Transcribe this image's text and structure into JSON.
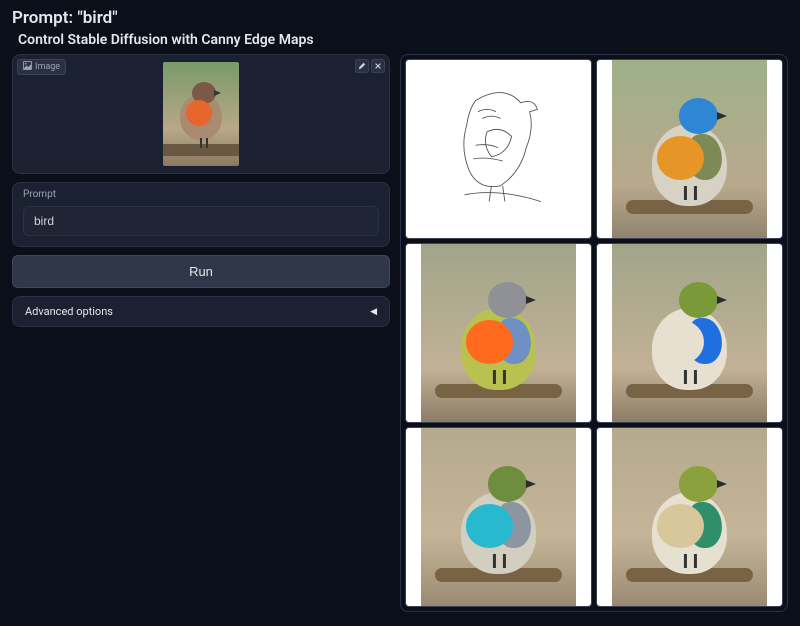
{
  "header": {
    "prompt_prefix": "Prompt: ",
    "prompt_value": "\"bird\"",
    "subtitle": "Control Stable Diffusion with Canny Edge Maps"
  },
  "image_input": {
    "chip_icon": "image-icon",
    "chip_label": "Image",
    "edit_icon": "pencil-icon",
    "close_icon": "close-icon"
  },
  "prompt_field": {
    "label": "Prompt",
    "value": "bird"
  },
  "run_button": {
    "label": "Run"
  },
  "advanced": {
    "label": "Advanced options",
    "expand_icon": "triangle-left-icon"
  },
  "outputs": [
    {
      "kind": "edge_map",
      "label": "canny-edge-map"
    },
    {
      "kind": "generated",
      "palette": {
        "head": "#2f86d4",
        "body": "#d8d2c4",
        "chest": "#e69627",
        "wing": "#7d8a55"
      }
    },
    {
      "kind": "generated",
      "palette": {
        "head": "#8f9196",
        "body": "#b9c24e",
        "chest": "#ff6a1f",
        "wing": "#6e90c4"
      }
    },
    {
      "kind": "generated",
      "palette": {
        "head": "#7a9a3a",
        "body": "#e7dfcf",
        "chest": "#e7dfcf",
        "wing": "#1f6fe0"
      }
    },
    {
      "kind": "generated",
      "palette": {
        "head": "#6f8d3f",
        "body": "#d2cec0",
        "chest": "#29b9cf",
        "wing": "#8c96a0"
      }
    },
    {
      "kind": "generated",
      "palette": {
        "head": "#8aa23e",
        "body": "#e5e0d0",
        "chest": "#d8c79a",
        "wing": "#2f8f6a"
      }
    }
  ],
  "colors": {
    "bg": "#0b0f1a",
    "panel": "#1b2131",
    "border": "#2a3142",
    "accent": "#2f3749"
  },
  "input_bird": {
    "head": "#7a5a46",
    "body": "#a98b70",
    "chest": "#e8652e"
  }
}
